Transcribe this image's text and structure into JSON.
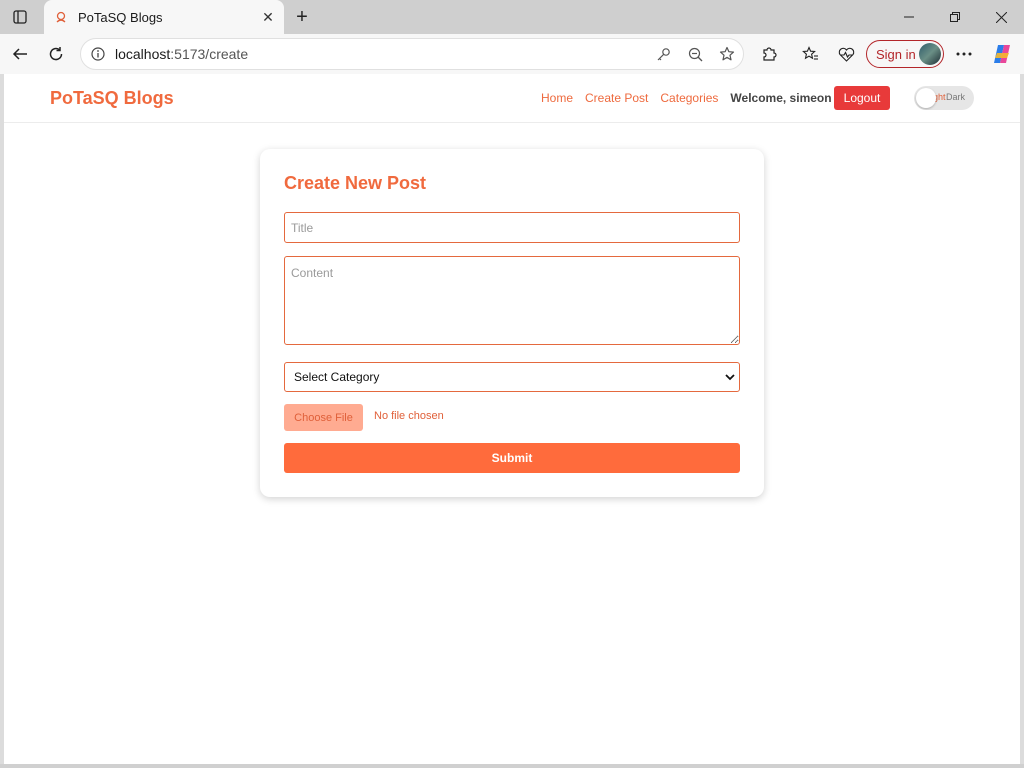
{
  "browser": {
    "tab_title": "PoTaSQ Blogs",
    "tab_close": "✕",
    "new_tab": "+",
    "url_host": "localhost",
    "url_path": ":5173/create",
    "signin_label": "Sign in"
  },
  "navbar": {
    "brand": "PoTaSQ Blogs",
    "links": [
      "Home",
      "Create Post",
      "Categories"
    ],
    "welcome": "Welcome, simeon",
    "logout": "Logout",
    "theme_light": "Light",
    "theme_dark": "Dark"
  },
  "form": {
    "heading": "Create New Post",
    "title_placeholder": "Title",
    "content_placeholder": "Content",
    "category_selected": "Select Category",
    "file_button": "Choose File",
    "file_status": "No file chosen",
    "submit": "Submit"
  },
  "colors": {
    "accent": "#f06a3e",
    "logout": "#e83a3a",
    "submit": "#ff6b3c"
  }
}
